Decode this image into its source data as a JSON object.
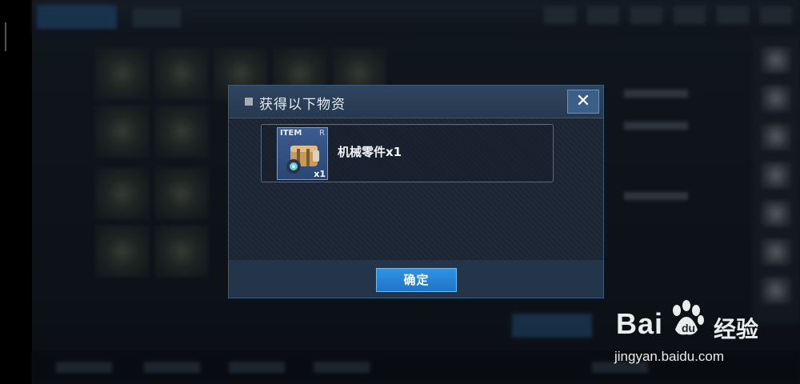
{
  "dialog": {
    "title": "获得以下物资",
    "close_glyph": "✕",
    "item": {
      "slot_label": "ITEM",
      "rarity": "R",
      "quantity": "x1",
      "name": "机械零件x1",
      "icon": "mechanical-parts-icon"
    },
    "confirm_label": "确定"
  },
  "watermark": {
    "brand": "Bai",
    "cn": "经验",
    "url": "jingyan.baidu.com"
  },
  "colors": {
    "dialog_bg": "#1b2533",
    "header_bg": "#2f4560",
    "confirm_button": "#2f93e6",
    "slot_bg": "#3b5c8f"
  }
}
